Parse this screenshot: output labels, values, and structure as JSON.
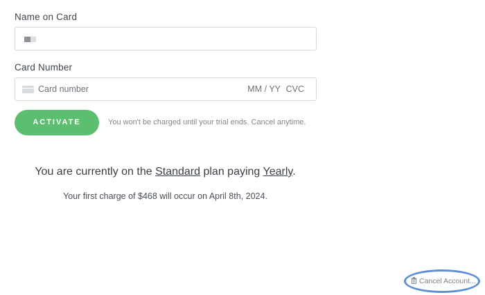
{
  "name_field": {
    "label": "Name on Card",
    "mask_colors": [
      "#8e9196",
      "#dcdee1"
    ]
  },
  "card_field": {
    "label": "Card Number",
    "number_placeholder": "Card number",
    "expiry_placeholder": "MM / YY",
    "cvc_placeholder": "CVC",
    "icon": "credit-card-icon"
  },
  "activate": {
    "label": "ACTIVATE",
    "note": "You won't be charged until your trial ends. Cancel anytime.",
    "color": "#5cbf70"
  },
  "plan": {
    "prefix": "You are currently on the ",
    "plan_name": "Standard",
    "middle": " plan paying ",
    "billing_cycle": "Yearly",
    "suffix": ".",
    "charge_note": "Your first charge of $468 will occur on April 8th, 2024."
  },
  "footer": {
    "cancel_label": "Cancel Account...",
    "icon": "trash-icon",
    "highlight_color": "#5f8fd1"
  }
}
